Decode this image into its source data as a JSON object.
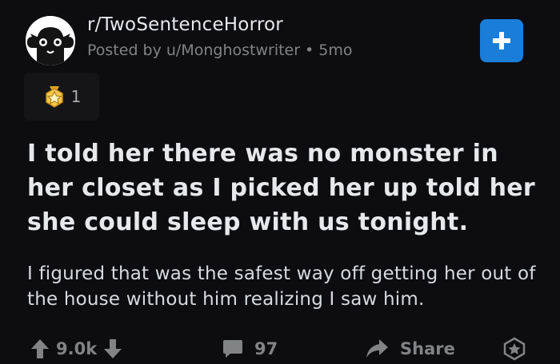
{
  "header": {
    "subreddit": "r/TwoSentenceHorror",
    "posted_by": "Posted by u/Monghostwriter",
    "separator": "•",
    "age": "5mo"
  },
  "join_button": {
    "icon": "plus-icon"
  },
  "award": {
    "icon": "award-icon",
    "count": "1"
  },
  "post": {
    "title": "I told her there was no monster in her closet as I picked her up told her she could sleep with us tonight.",
    "body": "I figured that was the safest way off getting her out of the house without him realizing I saw him."
  },
  "actions": {
    "vote_count": "9.0k",
    "comment_count": "97",
    "share_label": "Share"
  },
  "colors": {
    "background": "#0d0d10",
    "text_primary": "#e6e8ea",
    "text_muted": "#818384",
    "accent_blue": "#1a7ed8",
    "award_gold": "#f2c94c"
  }
}
